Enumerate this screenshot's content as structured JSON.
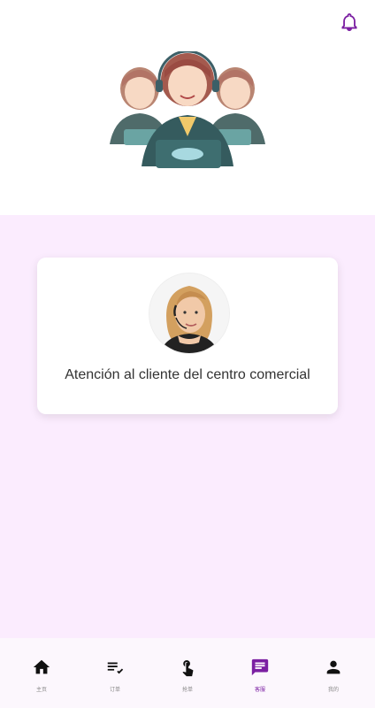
{
  "header": {
    "bell_icon": "bell-icon",
    "hero_image": "customer-service-team-illustration"
  },
  "service_card": {
    "avatar": "customer-service-agent-photo",
    "label": "Atención al cliente del centro comercial"
  },
  "bottom_nav": {
    "items": [
      {
        "label": "主页",
        "icon": "home-icon",
        "active": false
      },
      {
        "label": "订单",
        "icon": "checklist-icon",
        "active": false
      },
      {
        "label": "抢单",
        "icon": "tap-icon",
        "active": false
      },
      {
        "label": "客服",
        "icon": "chat-icon",
        "active": true
      },
      {
        "label": "我的",
        "icon": "person-icon",
        "active": false
      }
    ]
  },
  "colors": {
    "accent": "#7b1fa2",
    "background": "#fbecfe"
  }
}
